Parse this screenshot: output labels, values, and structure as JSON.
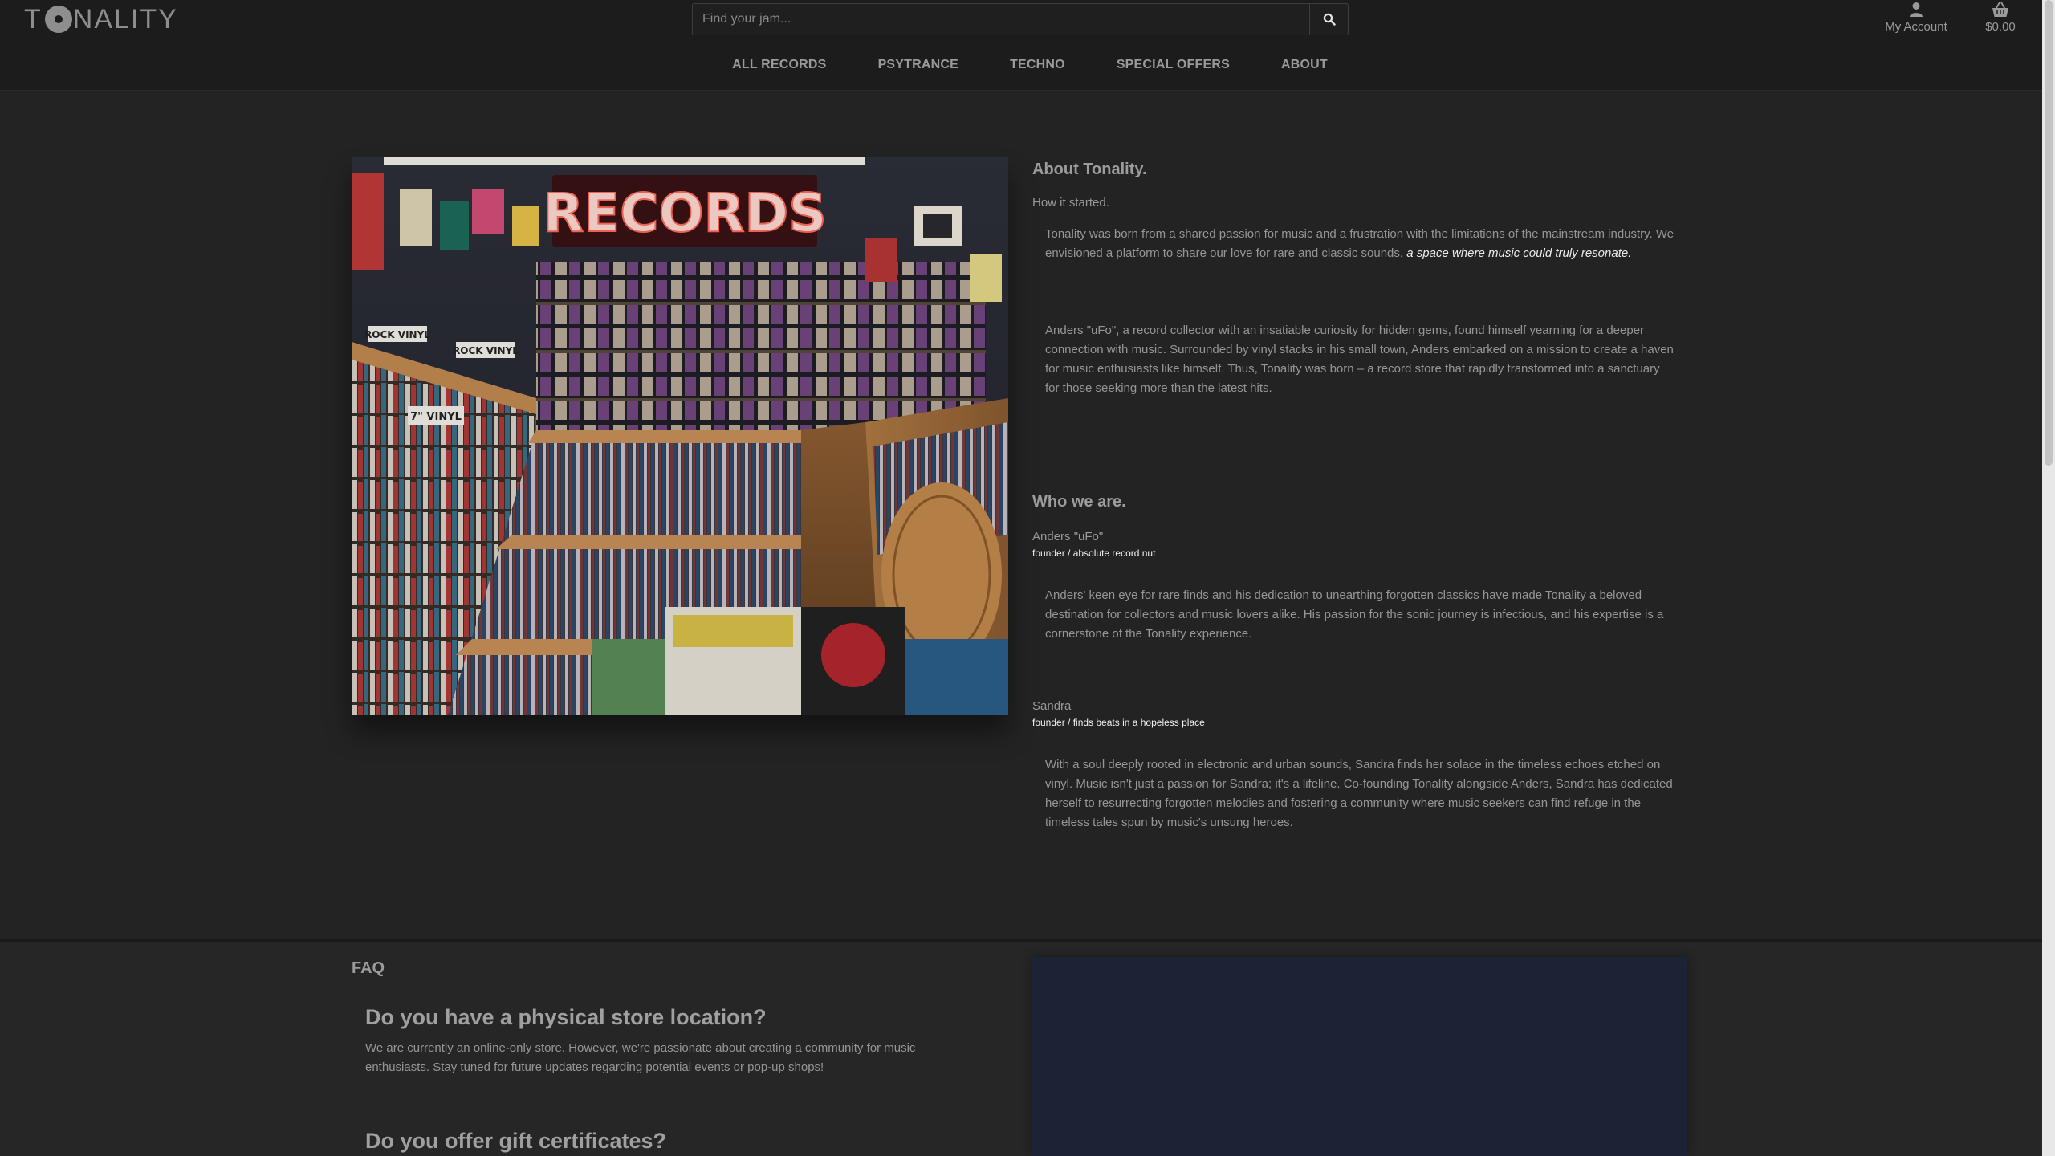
{
  "header": {
    "logo_text_before": "T",
    "logo_text_after": "NALITY",
    "search_placeholder": "Find your jam...",
    "account_label": "My Account",
    "cart_total": "$0.00",
    "nav": [
      "ALL RECORDS",
      "PSYTRANCE",
      "TECHNO",
      "SPECIAL OFFERS",
      "ABOUT"
    ]
  },
  "about": {
    "heading": "About Tonality.",
    "subheading": "How it started.",
    "para1_plain": "Tonality was born from a shared passion for music and a frustration with the limitations of the mainstream industry. We envisioned a platform to share our love for rare and classic sounds, ",
    "para1_emph": "a space where music could truly resonate.",
    "para2": "Anders \"uFo\", a record collector with an insatiable curiosity for hidden gems, found himself yearning for a deeper connection with music. Surrounded by vinyl stacks in his small town, Anders embarked on a mission to create a haven for music enthusiasts like himself. Thus, Tonality was born – a record store that rapidly transformed into a sanctuary for those seeking more than the latest hits."
  },
  "who": {
    "heading": "Who we are.",
    "people": [
      {
        "name": "Anders \"uFo\"",
        "role": "founder / absolute record nut",
        "bio": "Anders' keen eye for rare finds and his dedication to unearthing forgotten classics have made Tonality a beloved destination for collectors and music lovers alike. His passion for the sonic journey is infectious, and his expertise is a cornerstone of the Tonality experience."
      },
      {
        "name": "Sandra",
        "role": "founder / finds beats in a hopeless place",
        "bio": "With a soul deeply rooted in electronic and urban sounds, Sandra finds her solace in the timeless echoes etched on vinyl. Music isn't just a passion for Sandra; it's a lifeline. Co-founding Tonality alongside Anders, Sandra has dedicated herself to resurrecting forgotten melodies and fostering a community where music seekers can find refuge in the timeless tales spun by music's unsung heroes."
      }
    ]
  },
  "photo": {
    "sign_text": "RECORDS",
    "bin_labels": [
      "ROCK VINYL",
      "ROCK VINYL",
      "7\" VINYL"
    ]
  },
  "faq": {
    "heading": "FAQ",
    "items": [
      {
        "question": "Do you have a physical store location?",
        "answer": "We are currently an online-only store. However, we're passionate about creating a community for music enthusiasts. Stay tuned for future updates regarding potential events or pop-up shops!"
      },
      {
        "question": "Do you offer gift certificates?",
        "answer": ""
      }
    ]
  },
  "colors": {
    "page_bg": "#232323",
    "header_bg": "#1c1c1c",
    "text": "#9a9a9a",
    "emphasis": "#ececec",
    "map_panel": "#1c2335"
  }
}
